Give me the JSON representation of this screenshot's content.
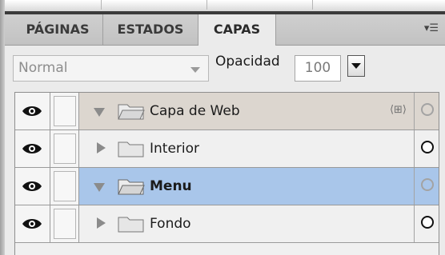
{
  "tabs": [
    {
      "label": "PÁGINAS",
      "active": false
    },
    {
      "label": "ESTADOS",
      "active": false
    },
    {
      "label": "CAPAS",
      "active": true
    }
  ],
  "panel_menu_icon": "panel-menu-icon",
  "blend_mode": {
    "value": "Normal",
    "options_visible": false
  },
  "opacity": {
    "label": "Opacidad",
    "value": "100"
  },
  "layers": [
    {
      "name": "Capa de Web",
      "expanded": true,
      "bold": false,
      "style": "group",
      "visible": true
    },
    {
      "name": "Interior",
      "expanded": false,
      "bold": false,
      "style": "plain",
      "visible": true
    },
    {
      "name": "Menu",
      "expanded": true,
      "bold": true,
      "style": "selected",
      "visible": true
    },
    {
      "name": "Fondo",
      "expanded": false,
      "bold": false,
      "style": "plain",
      "visible": true
    }
  ],
  "colors": {
    "selected_row": "#a9c6ea",
    "group_row": "#dcd6cf",
    "panel_bg": "#ebebeb"
  }
}
